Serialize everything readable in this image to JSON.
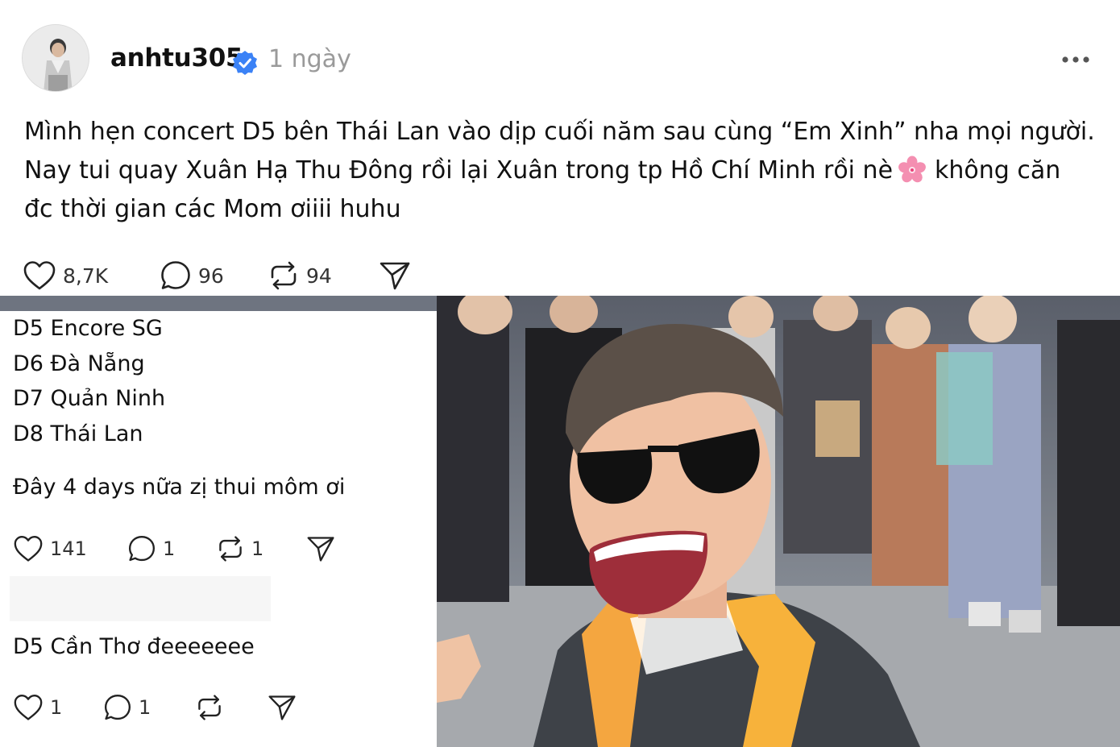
{
  "post": {
    "username": "anhtu305",
    "timestamp": "1 ngày",
    "caption_lines": [
      "Mình hẹn concert D5 bên Thái Lan vào dịp cuối năm sau cùng “Em Xinh” nha mọi người.",
      "Nay tui quay Xuân Hạ Thu Đông rồi lại Xuân trong tp Hồ Chí Minh rồi nè",
      "không căn",
      "đc thời gian các Mom ơiiii huhu"
    ],
    "actions": {
      "likes": "8,7K",
      "comments": "96",
      "reposts": "94"
    }
  },
  "embedded": {
    "schedule": [
      "D5 Encore SG",
      "D6 Đà Nẵng",
      "D7 Quản Ninh",
      "D8 Thái Lan"
    ],
    "note": "Đây 4 days nữa zị thui môm ơi",
    "note_actions": {
      "likes": "141",
      "comments": "1",
      "reposts": "1"
    },
    "second_note": "D5 Cần Thơ đeeeeeee",
    "second_actions": {
      "likes": "1",
      "comments": "1"
    }
  },
  "icons": {
    "verified": "verified-badge-icon",
    "more": "more-options-icon",
    "like": "heart-icon",
    "comment": "comment-bubble-icon",
    "repost": "repost-icon",
    "share": "send-icon",
    "flower": "cherry-blossom-emoji"
  },
  "colors": {
    "verified": "#3b82f6",
    "timestamp": "#9a9a9a",
    "flower": "#f48fb1"
  }
}
